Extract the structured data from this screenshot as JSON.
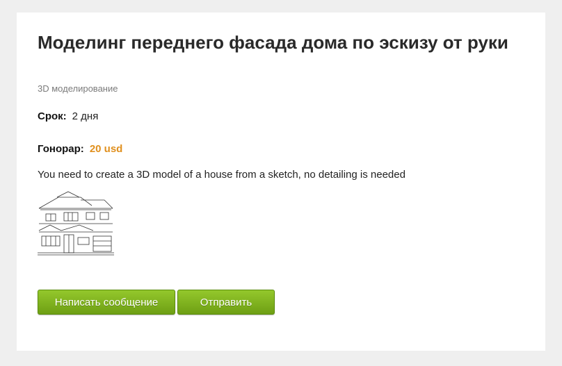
{
  "job": {
    "title": "Моделинг переднего фасада дома по эскизу от руки",
    "category": "3D моделирование",
    "deadline_label": "Срок:",
    "deadline_value": "2 дня",
    "fee_label": "Гонорар:",
    "fee_value": "20 usd",
    "description": "You need to create a 3D model of a house from a sketch, no detailing is needed"
  },
  "actions": {
    "message_label": "Написать сообщение",
    "send_label": "Отправить"
  },
  "colors": {
    "accent_fee": "#e0901e",
    "button_green": "#7fb11d"
  }
}
